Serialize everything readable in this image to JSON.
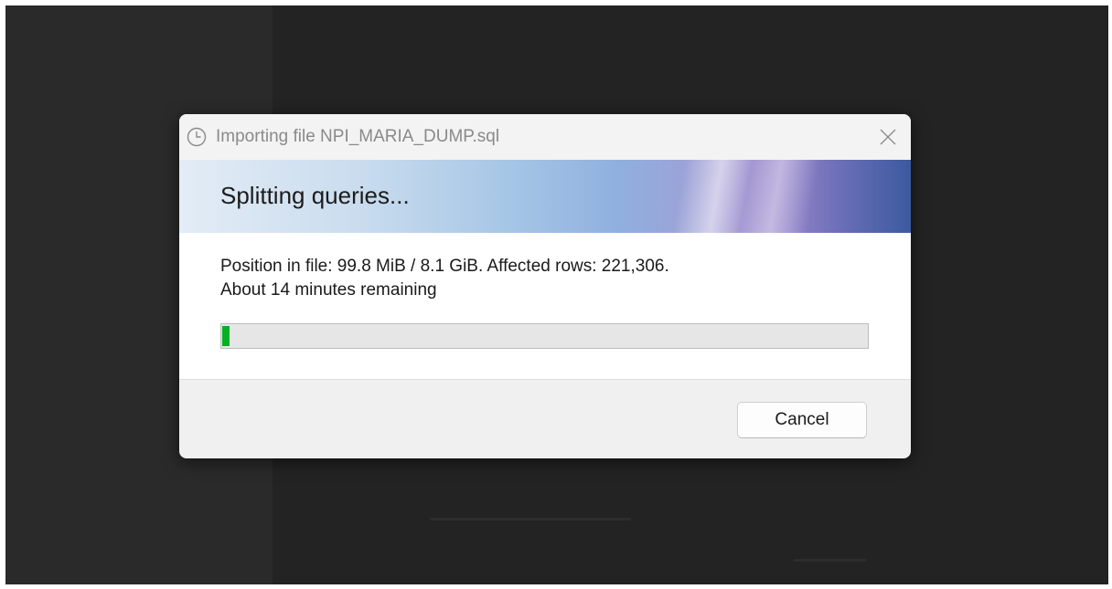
{
  "dialog": {
    "title": "Importing file NPI_MARIA_DUMP.sql",
    "title_icon": "clock-icon",
    "close_icon": "close-icon",
    "banner_text": "Splitting queries...",
    "status_line1": "Position in file: 99.8 MiB / 8.1 GiB. Affected rows: 221,306.",
    "status_line2": "About 14 minutes remaining",
    "progress_fraction": 0.012,
    "cancel_label": "Cancel"
  },
  "colors": {
    "progress_fill": "#06b025",
    "desktop_background": "#232323",
    "dialog_background": "#f0f0f0"
  }
}
